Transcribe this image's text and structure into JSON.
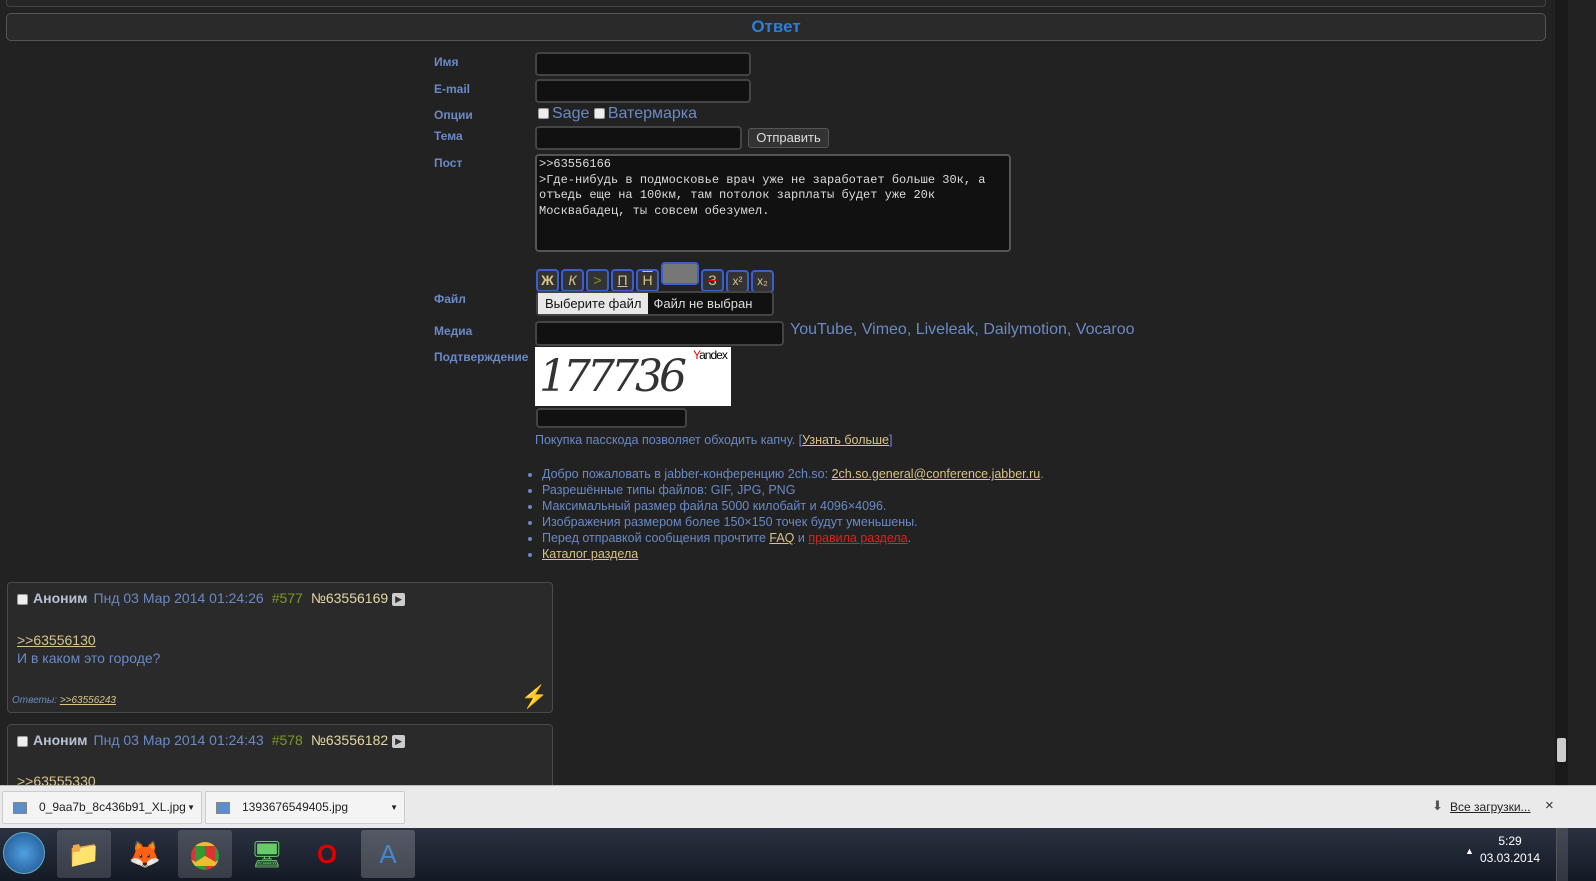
{
  "reply_title": "Ответ",
  "form": {
    "name_label": "Имя",
    "email_label": "E-mail",
    "options_label": "Опции",
    "sage": "Sage",
    "watermark": "Ватермарка",
    "subject_label": "Тема",
    "submit": "Отправить",
    "post_label": "Пост",
    "post_text": ">>63556166\n>Где-нибудь в подмосковье врач уже не заработает больше 30к, а отъедь еще на 100км, там потолок зарплаты будет уже 20к\nМосквабадец, ты совсем обезумел.",
    "markup": [
      "Ж",
      "К",
      ">",
      "П",
      "Н",
      "",
      "З",
      "x²",
      "x₂"
    ],
    "file_label": "Файл",
    "file_button": "Выберите файл",
    "file_status": "Файл не выбран",
    "media_label": "Медиа",
    "media_services": "YouTube, Vimeo, Liveleak, Dailymotion, Vocaroo",
    "captcha_label": "Подтверждение",
    "captcha_brand": "Yandex",
    "captcha_text": "177736",
    "passcode_text": "Покупка пасскода позволяет обходить капчу. [",
    "passcode_link": "Узнать больше",
    "passcode_end": "]"
  },
  "rules": {
    "r1": "Добро пожаловать в jabber-конференцию 2ch.so: ",
    "r1_link": "2ch.so.general@conference.jabber.ru",
    "r1_end": ".",
    "r2": "Разрешённые типы файлов: GIF, JPG, PNG",
    "r3": "Максимальный размер файла 5000 килобайт и 4096×4096.",
    "r4": "Изображения размером более 150×150 точек будут уменьшены.",
    "r5": "Перед отправкой сообщения прочтите ",
    "r5_faq": "FAQ",
    "r5_and": " и ",
    "r5_rules": "правила раздела",
    "r5_end": ".",
    "r6": "Каталог раздела"
  },
  "posts": [
    {
      "author": "Аноним",
      "date": "Пнд 03 Мар 2014 01:24:26",
      "num": "#577",
      "no": "№63556169",
      "reply_link": ">>63556130",
      "text": "И в каком это городе?",
      "answers_label": "Ответы:",
      "answers": ">>63556243"
    },
    {
      "author": "Аноним",
      "date": "Пнд 03 Мар 2014 01:24:43",
      "num": "#578",
      "no": "№63556182",
      "reply_link": ">>63555330"
    }
  ],
  "downloads": {
    "items": [
      "0_9aa7b_8c436b91_XL.jpg",
      "1393676549405.jpg"
    ],
    "all": "Все загрузки...",
    "close": "×"
  },
  "taskbar": {
    "time": "5:29",
    "date": "03.03.2014"
  }
}
